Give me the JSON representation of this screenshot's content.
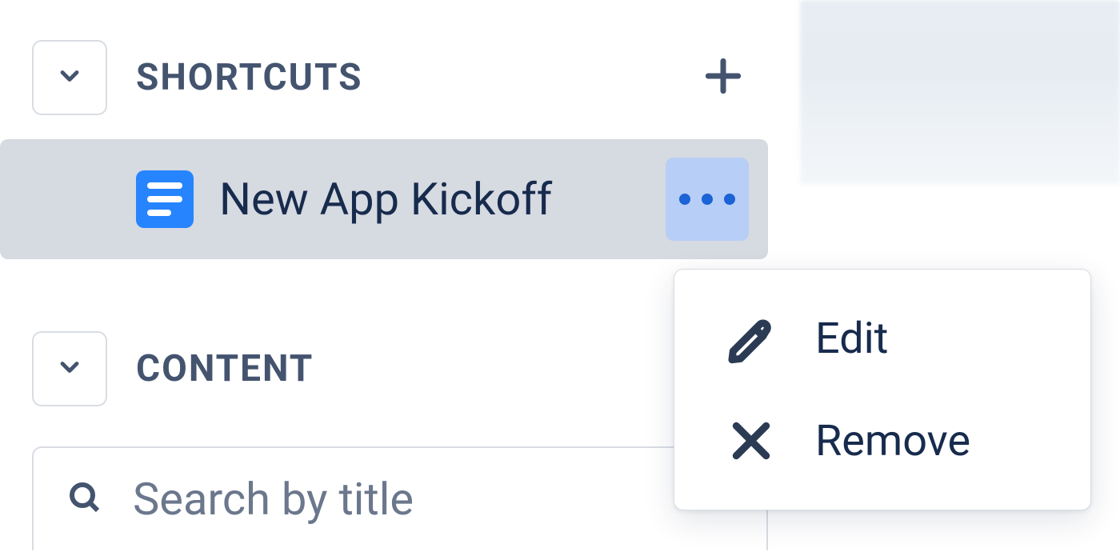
{
  "sidebar": {
    "shortcuts": {
      "title": "SHORTCUTS",
      "items": [
        {
          "label": "New App Kickoff",
          "icon": "page-icon"
        }
      ]
    },
    "content": {
      "title": "CONTENT",
      "search_placeholder": "Search by title"
    }
  },
  "context_menu": {
    "items": [
      {
        "label": "Edit",
        "icon": "pencil-icon"
      },
      {
        "label": "Remove",
        "icon": "close-icon"
      }
    ]
  }
}
